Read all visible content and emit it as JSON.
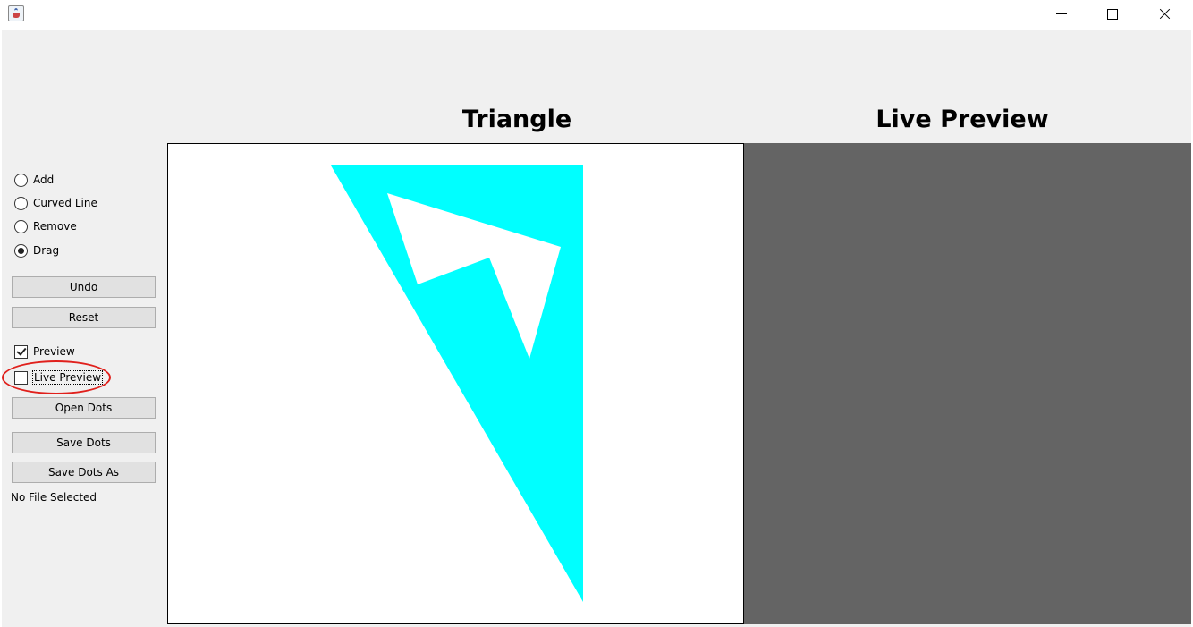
{
  "window": {
    "controls": [
      "minimize-icon",
      "maximize-icon",
      "close-icon"
    ]
  },
  "modes": {
    "options": [
      {
        "label": "Add",
        "selected": false
      },
      {
        "label": "Curved Line",
        "selected": false
      },
      {
        "label": "Remove",
        "selected": false
      },
      {
        "label": "Drag",
        "selected": true
      }
    ]
  },
  "buttons": {
    "undo": "Undo",
    "reset": "Reset",
    "open_dots": "Open Dots",
    "save_dots": "Save Dots",
    "save_dots_as": "Save Dots As"
  },
  "checkboxes": {
    "preview": {
      "label": "Preview",
      "checked": true
    },
    "live_preview": {
      "label": "Live Preview",
      "checked": false
    }
  },
  "status": {
    "file": "No File Selected"
  },
  "panels": {
    "triangle_title": "Triangle",
    "live_preview_title": "Live Preview"
  },
  "colors": {
    "shape_fill": "#00ffff",
    "preview_background": "#646464",
    "annotation": "#e0201c"
  }
}
